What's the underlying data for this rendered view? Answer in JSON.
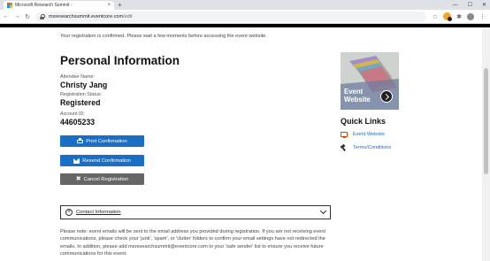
{
  "browser": {
    "tab_title": "Microsoft Research Summit -",
    "tab_close": "×",
    "new_tab": "+",
    "url_host": "msresearchsummit.eventcore.com",
    "url_path": "/edit",
    "profile_initial": "",
    "window_minimize": "—",
    "window_maximize": "☐",
    "window_close": "✕",
    "nav_back": "←",
    "nav_forward": "→",
    "nav_reload": "↻",
    "star": "☆",
    "extensions": "✱",
    "menu": "⋮"
  },
  "page": {
    "notice": "Your registration is confirmed. Please wait a few moments before accessing the event website.",
    "heading": "Personal Information",
    "attendee_label": "Attendee Name:",
    "attendee_value": "Christy Jang",
    "status_label": "Registration Status:",
    "status_value": "Registered",
    "account_label": "Account ID:",
    "account_value": "44605233",
    "buttons": {
      "print": "Print Confirmation",
      "resend": "Resend Confirmation",
      "cancel": "Cancel Registration"
    },
    "accordion_label": "Contact Information",
    "footnote": "Please note: event emails will be sent to the email address you provided during registration. If you are not receiving event communications, please check your 'junk', 'spam', or 'clutter' folders to confirm your email settings have not redirected the emails. In addition, please add msresearchsummit@eventcore.com to your 'safe sender' list to ensure you receive future communications for this event."
  },
  "sidebar": {
    "tile_line1": "Event",
    "tile_line2": "Website",
    "quick_links_title": "Quick Links",
    "links": [
      {
        "label": "Event Website",
        "icon": "monitor-icon"
      },
      {
        "label": "Terms/Conditions",
        "icon": "gavel-icon"
      }
    ]
  },
  "colors": {
    "accent_blue": "#1a6fc4",
    "cancel_grey": "#666666",
    "monitor_orange": "#d04a02"
  }
}
